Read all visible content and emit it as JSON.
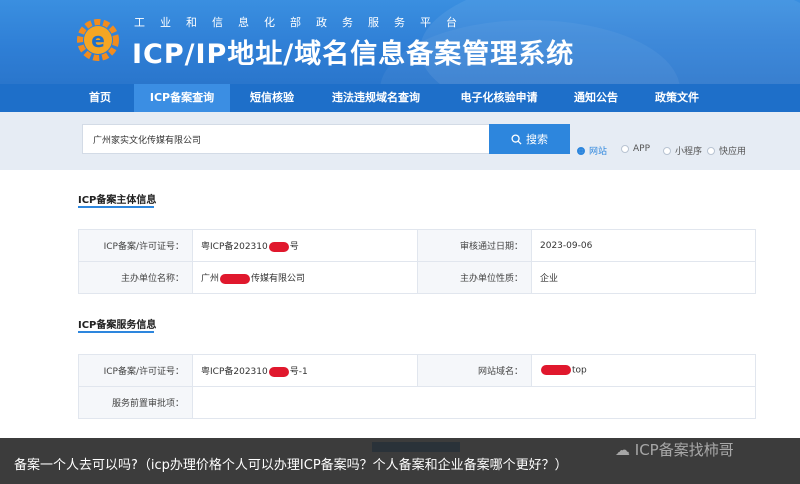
{
  "header": {
    "subtitle": "工业和信息化部政务服务平台",
    "title": "ICP/IP地址/域名信息备案管理系统"
  },
  "nav": {
    "items": [
      {
        "label": "首页"
      },
      {
        "label": "ICP备案查询"
      },
      {
        "label": "短信核验"
      },
      {
        "label": "违法违规域名查询"
      },
      {
        "label": "电子化核验申请"
      },
      {
        "label": "通知公告"
      },
      {
        "label": "政策文件"
      }
    ],
    "active_index": 1
  },
  "search": {
    "value": "广州家实文化传媒有限公司",
    "button_label": "搜索",
    "options": [
      "网站",
      "APP",
      "小程序",
      "快应用"
    ],
    "selected": "网站"
  },
  "entity_section": {
    "title": "ICP备案主体信息",
    "rows": [
      {
        "label1": "ICP备案/许可证号：",
        "value1_prefix": "粤ICP备202310",
        "value1_suffix": "号",
        "label2": "审核通过日期：",
        "value2": "2023-09-06"
      },
      {
        "label1": "主办单位名称：",
        "value1_prefix": "广州",
        "value1_suffix": "传媒有限公司",
        "label2": "主办单位性质：",
        "value2": "企业"
      }
    ]
  },
  "service_section": {
    "title": "ICP备案服务信息",
    "rows": [
      {
        "label1": "ICP备案/许可证号：",
        "value1_prefix": "粤ICP备202310",
        "value1_suffix": "号-1",
        "label2": "网站域名：",
        "value2_suffix": "top"
      },
      {
        "label1": "服务前置审批项：",
        "value1": ""
      }
    ]
  },
  "overlay": {
    "caption": "备案一个人去可以吗?（icp办理价格个人可以办理ICP备案吗？个人备案和企业备案哪个更好？）",
    "watermark": "ICP备案找柿哥"
  },
  "colors": {
    "header_blue": "#2f7fd6",
    "nav_blue": "#1e6fc9",
    "accent": "#2d86dd",
    "redaction": "#e0182d"
  }
}
